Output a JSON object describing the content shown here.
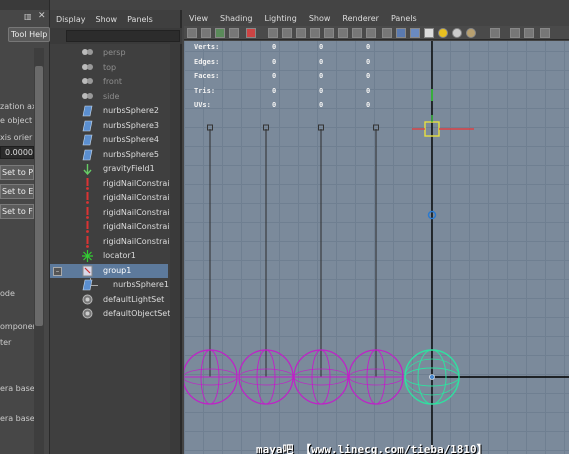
{
  "attribute_editor": {
    "tab": "Tool Help",
    "labels": [
      "zation ax",
      "e object",
      "xis orier"
    ],
    "value": "0.0000",
    "buttons": [
      "Set to P",
      "Set to E",
      "Set to F"
    ],
    "labels2": [
      "ode",
      "omponen",
      "ter",
      "era base",
      "era base"
    ]
  },
  "outliner": {
    "menu": [
      "Display",
      "Show",
      "Panels"
    ],
    "items": [
      {
        "label": "persp",
        "dim": true
      },
      {
        "label": "top",
        "dim": true
      },
      {
        "label": "front",
        "dim": true
      },
      {
        "label": "side",
        "dim": true
      },
      {
        "label": "nurbsSphere2",
        "dim": false
      },
      {
        "label": "nurbsSphere3",
        "dim": false
      },
      {
        "label": "nurbsSphere4",
        "dim": false
      },
      {
        "label": "nurbsSphere5",
        "dim": false
      },
      {
        "label": "gravityField1",
        "dim": false
      },
      {
        "label": "rigidNailConstraint",
        "dim": false
      },
      {
        "label": "rigidNailConstraint",
        "dim": false
      },
      {
        "label": "rigidNailConstraint",
        "dim": false
      },
      {
        "label": "rigidNailConstraint",
        "dim": false
      },
      {
        "label": "rigidNailConstraint",
        "dim": false
      },
      {
        "label": "locator1",
        "dim": false
      },
      {
        "label": "group1",
        "dim": false,
        "selected": true
      },
      {
        "label": "nurbsSphere1",
        "dim": false,
        "child": true
      },
      {
        "label": "defaultLightSet",
        "dim": false
      },
      {
        "label": "defaultObjectSet",
        "dim": false
      }
    ]
  },
  "viewport": {
    "menu": [
      "View",
      "Shading",
      "Lighting",
      "Show",
      "Renderer",
      "Panels"
    ],
    "hud": [
      {
        "label": "Verts:",
        "values": [
          "0",
          "0",
          "0"
        ]
      },
      {
        "label": "Edges:",
        "values": [
          "0",
          "0",
          "0"
        ]
      },
      {
        "label": "Faces:",
        "values": [
          "0",
          "0",
          "0"
        ]
      },
      {
        "label": "Tris:",
        "values": [
          "0",
          "0",
          "0"
        ]
      },
      {
        "label": "UVs:",
        "values": [
          "0",
          "0",
          "0"
        ]
      }
    ],
    "watermark": "maya吧 【www.linecg.com/tieba/1810】",
    "colors": {
      "sphere": "#c020c8",
      "selected_sphere": "#30e0a0",
      "axis": "#000000",
      "locator": "#e8e040"
    }
  }
}
